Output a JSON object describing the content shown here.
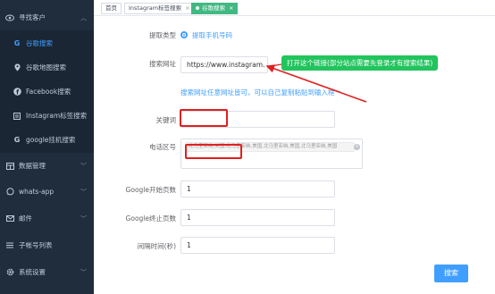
{
  "sidebar": {
    "items": [
      {
        "label": "寻找客户",
        "icon": "eye-icon",
        "arrow": "︿"
      },
      {
        "label": "谷歌搜索",
        "icon": "google-icon"
      },
      {
        "label": "谷歌地图搜索",
        "icon": "map-pin-icon"
      },
      {
        "label": "Facebook搜索",
        "icon": "facebook-icon"
      },
      {
        "label": "Instagram标签搜索",
        "icon": "list-icon"
      },
      {
        "label": "google挂机搜索",
        "icon": "google-icon"
      },
      {
        "label": "数据管理",
        "icon": "table-icon",
        "arrow": "﹀"
      },
      {
        "label": "whats-app",
        "icon": "whatsapp-icon",
        "arrow": "﹀"
      },
      {
        "label": "邮件",
        "icon": "mail-icon",
        "arrow": "﹀"
      },
      {
        "label": "子帐号列表",
        "icon": "bars-icon"
      },
      {
        "label": "系统设置",
        "icon": "gear-icon",
        "arrow": "﹀"
      }
    ]
  },
  "tabs": [
    {
      "label": "首页"
    },
    {
      "label": "Instagram标签搜索",
      "close": "×"
    },
    {
      "label": "谷歌搜索",
      "close": "×"
    }
  ],
  "form": {
    "extract_type_label": "提取类型",
    "extract_type_value": "提取手机号码",
    "url_label": "搜索网址",
    "url_value": "https://www.instagram.",
    "url_tip": "打开这个链接(部分站点需要先登录才有搜索结果)",
    "url_hint": "搜索网址任意网址皆可，可以自己复制粘贴到输入框",
    "keyword_label": "关键词",
    "keyword_value": "",
    "area_code_label": "电话区号",
    "area_code_tags": "北马里亚纳,美国,北马里亚纳,美国,北马里亚纳,美国,北马里亚纳,美国",
    "area_clear": "×",
    "start_page_label": "Google开始页数",
    "start_page_value": "1",
    "end_page_label": "Google终止页数",
    "end_page_value": "1",
    "interval_label": "间隔时间(秒)",
    "interval_value": "1",
    "search_button": "搜索"
  },
  "colors": {
    "sidebar_bg": "#1f2d3d",
    "accent": "#409eff",
    "tip_green": "#21c45d",
    "active_tab": "#42b983",
    "annotation_red": "#e02020"
  }
}
